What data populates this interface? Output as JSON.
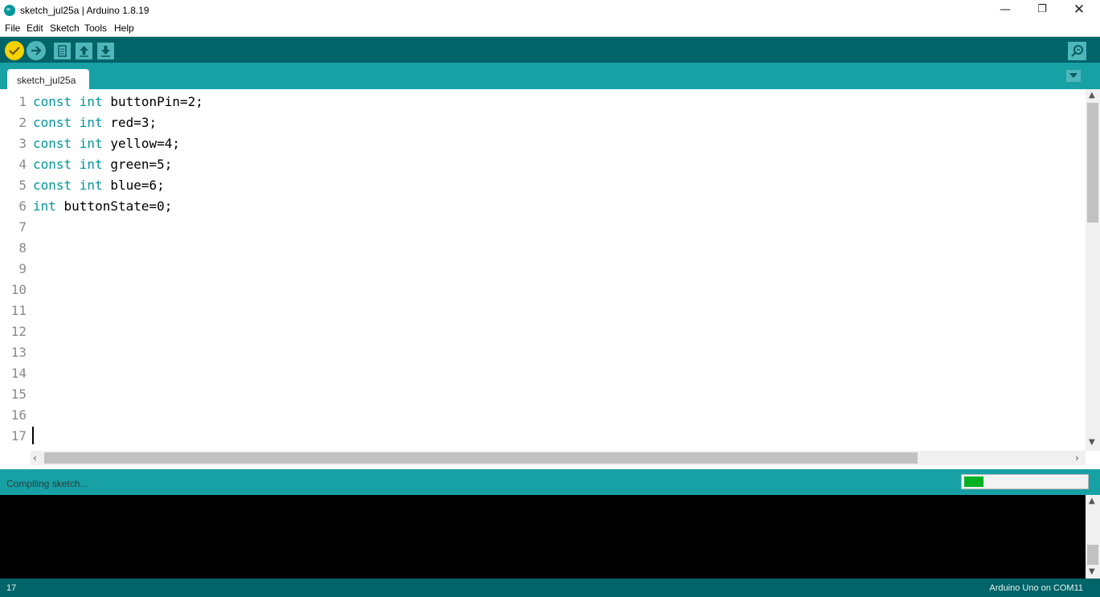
{
  "window": {
    "title": "sketch_jul25a | Arduino 1.8.19",
    "minimize_glyph": "—",
    "maximize_glyph": "❐",
    "close_glyph": "✕",
    "logo_glyph": "∞"
  },
  "menu": {
    "items": [
      {
        "label": "File"
      },
      {
        "label": "Edit"
      },
      {
        "label": "Sketch"
      },
      {
        "label": "Tools"
      },
      {
        "label": "Help"
      }
    ]
  },
  "toolbar": {
    "buttons": [
      {
        "name": "verify",
        "icon": "checkmark-icon"
      },
      {
        "name": "upload",
        "icon": "arrow-right-icon"
      },
      {
        "name": "new",
        "icon": "file-icon"
      },
      {
        "name": "open",
        "icon": "arrow-up-icon"
      },
      {
        "name": "save",
        "icon": "arrow-down-icon"
      },
      {
        "name": "serial-monitor",
        "icon": "magnifier-icon"
      }
    ]
  },
  "tabs": [
    {
      "label": "sketch_jul25a",
      "active": true
    }
  ],
  "editor": {
    "line_numbers": [
      "1",
      "2",
      "3",
      "4",
      "5",
      "6",
      "7",
      "8",
      "9",
      "10",
      "11",
      "12",
      "13",
      "14",
      "15",
      "16",
      "17"
    ],
    "lines": [
      {
        "keyword": "const int",
        "rest": " buttonPin=2;"
      },
      {
        "keyword": "const int",
        "rest": " red=3;"
      },
      {
        "keyword": "const int",
        "rest": " yellow=4;"
      },
      {
        "keyword": "const int",
        "rest": " green=5;"
      },
      {
        "keyword": "const int",
        "rest": " blue=6;"
      },
      {
        "keyword": "int",
        "rest": " buttonState=0;"
      }
    ],
    "scroll_arrows": {
      "up": "▲",
      "down": "▼",
      "left": "‹",
      "right": "›"
    }
  },
  "status": {
    "message": "Compiling sketch...",
    "progress_fraction": 0.16
  },
  "footer": {
    "line": "17",
    "board": "Arduino Uno on COM11"
  },
  "colors": {
    "toolbar": "#006468",
    "tabbar": "#17a1a5",
    "keyword": "#00979c",
    "verify_button": "#f5d200",
    "progress_fill": "#06b025"
  }
}
